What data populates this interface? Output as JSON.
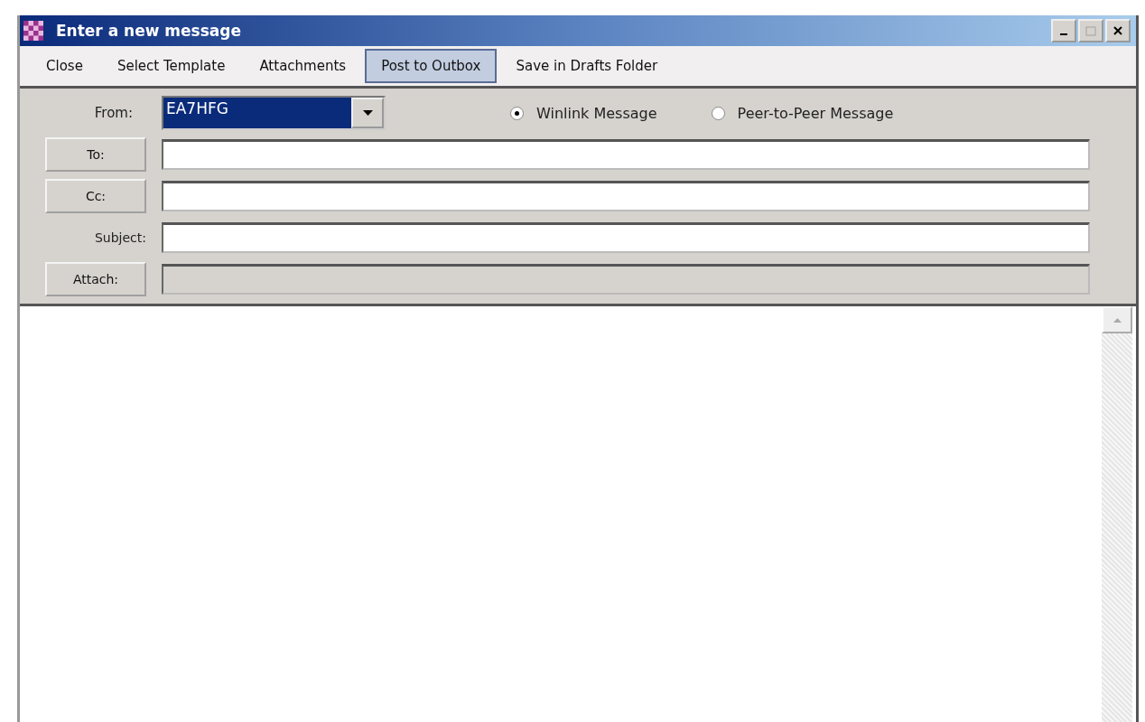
{
  "window": {
    "title": "Enter a new message"
  },
  "menu": [
    {
      "label": "Close",
      "selected": false
    },
    {
      "label": "Select Template",
      "selected": false
    },
    {
      "label": "Attachments",
      "selected": false
    },
    {
      "label": "Post to Outbox",
      "selected": true
    },
    {
      "label": "Save in Drafts Folder",
      "selected": false
    }
  ],
  "from": {
    "label": "From:",
    "value": "EA7HFG"
  },
  "message_type": [
    {
      "label": "Winlink Message",
      "selected": true
    },
    {
      "label": "Peer-to-Peer Message",
      "selected": false
    }
  ],
  "fields": [
    {
      "kind": "button",
      "label": "To:",
      "disabled": false
    },
    {
      "kind": "button",
      "label": "Cc:",
      "disabled": false
    },
    {
      "kind": "label",
      "label": "Subject:",
      "disabled": false
    },
    {
      "kind": "button",
      "label": "Attach:",
      "disabled": true
    }
  ]
}
